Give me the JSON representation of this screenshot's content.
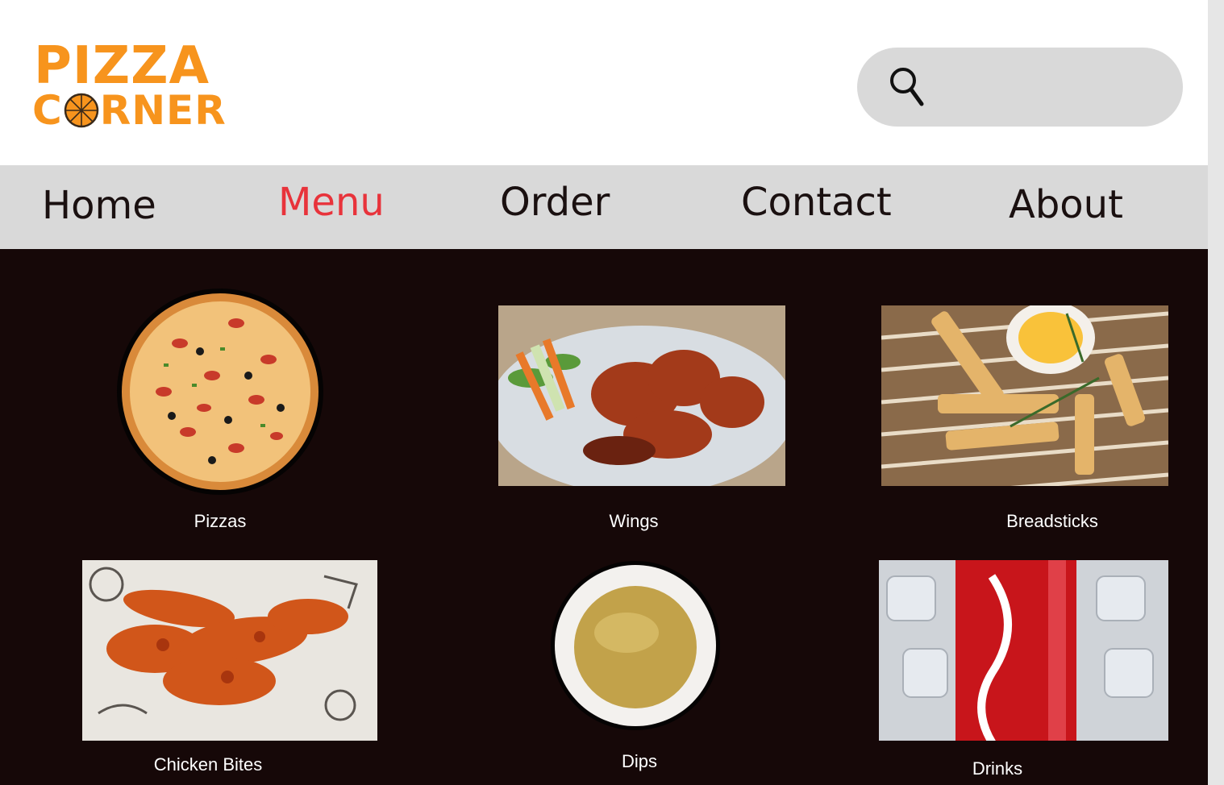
{
  "header": {
    "logo_line1": "PIZZA",
    "logo_line2_pre": "C",
    "logo_line2_post": "RNER",
    "brand_color": "#f7941d",
    "search": {
      "value": "",
      "placeholder": ""
    }
  },
  "nav": {
    "items": [
      {
        "label": "Home",
        "active": false
      },
      {
        "label": "Menu",
        "active": true
      },
      {
        "label": "Order",
        "active": false
      },
      {
        "label": "Contact",
        "active": false
      },
      {
        "label": "About",
        "active": false
      }
    ],
    "active_color": "#e8333b"
  },
  "menu": {
    "categories": [
      {
        "label": "Pizzas",
        "icon": "pizza-image"
      },
      {
        "label": "Wings",
        "icon": "wings-image"
      },
      {
        "label": "Breadsticks",
        "icon": "breadsticks-image"
      },
      {
        "label": "Chicken Bites",
        "icon": "chicken-bites-image"
      },
      {
        "label": "Dips",
        "icon": "dips-image"
      },
      {
        "label": "Drinks",
        "icon": "drinks-image"
      }
    ]
  }
}
